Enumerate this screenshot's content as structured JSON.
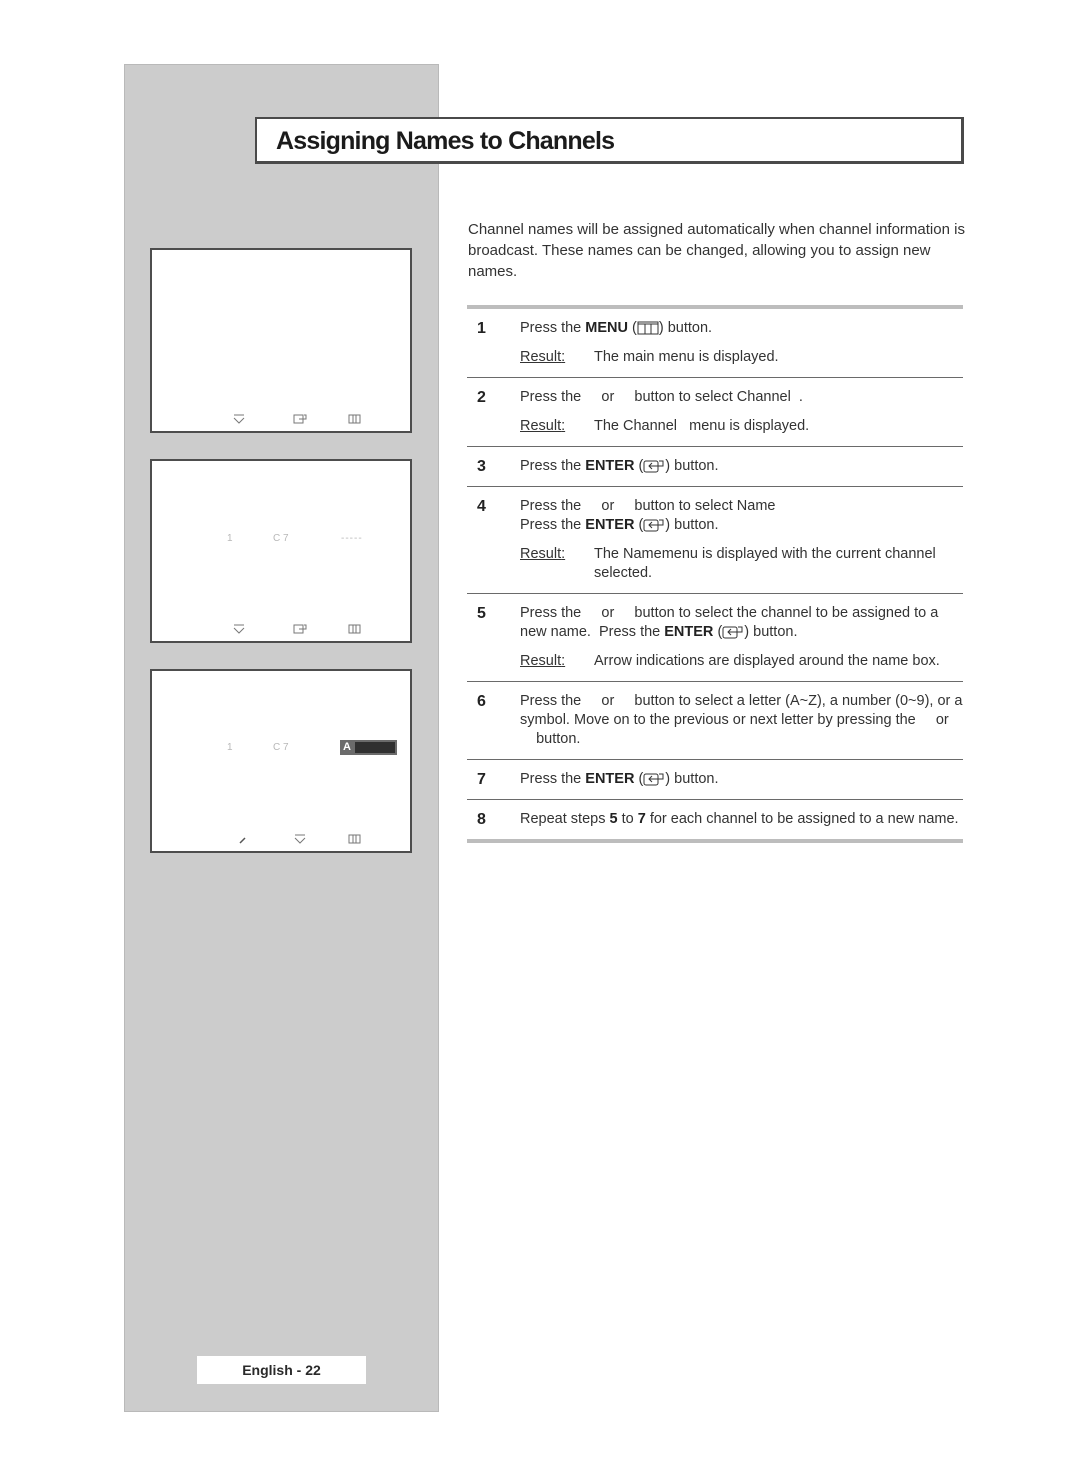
{
  "page": {
    "title": "Assigning Names to Channels",
    "intro": "Channel names will be assigned automatically when channel information is broadcast. These names can be changed, allowing you to assign new names.",
    "footer": "English - 22"
  },
  "screens": [
    {
      "icons": [
        "move-icon",
        "enter-icon",
        "menu-icon"
      ]
    },
    {
      "row": {
        "number": "1",
        "channel": "C 7",
        "name": "-----"
      },
      "icons": [
        "move-icon",
        "enter-icon",
        "menu-icon"
      ]
    },
    {
      "row": {
        "number": "1",
        "channel": "C 7",
        "name_letter": "A"
      },
      "icons": [
        "edit-icon",
        "move-icon",
        "menu-icon"
      ]
    }
  ],
  "labels": {
    "result": "Result",
    "colon": ":"
  },
  "steps": [
    {
      "num": "1",
      "pre": "Press the ",
      "bold": "MENU",
      "icon": "menu-icon",
      "post": " button.",
      "result": "The main menu is displayed."
    },
    {
      "num": "2",
      "text": "Press the     or     button to select Channel  .",
      "result": "The Channel   menu is displayed."
    },
    {
      "num": "3",
      "pre": "Press the ",
      "bold": "ENTER",
      "icon": "enter-icon",
      "post": " button."
    },
    {
      "num": "4",
      "text": "Press the     or     button to select Name",
      "pre": "Press the ",
      "bold": "ENTER",
      "icon": "enter-icon",
      "post": " button.",
      "result": "The Namemenu is displayed with the current channel selected."
    },
    {
      "num": "5",
      "text": "Press the     or     button to select the channel to be assigned to a new name.  Press the ",
      "bold": "ENTER",
      "icon": "enter-icon",
      "post": " button.",
      "result": "Arrow indications are displayed around the name box."
    },
    {
      "num": "6",
      "text": "Press the     or     button to select a letter (A~Z), a number (0~9), or a symbol. Move on to the previous or next letter by pressing the     or     button."
    },
    {
      "num": "7",
      "pre": "Press the ",
      "bold": "ENTER",
      "icon": "enter-icon",
      "post": " button."
    },
    {
      "num": "8",
      "pre": "Repeat steps ",
      "b1": "5",
      "mid": " to ",
      "b2": "7",
      "post": " for each channel to be assigned to a new name."
    }
  ]
}
